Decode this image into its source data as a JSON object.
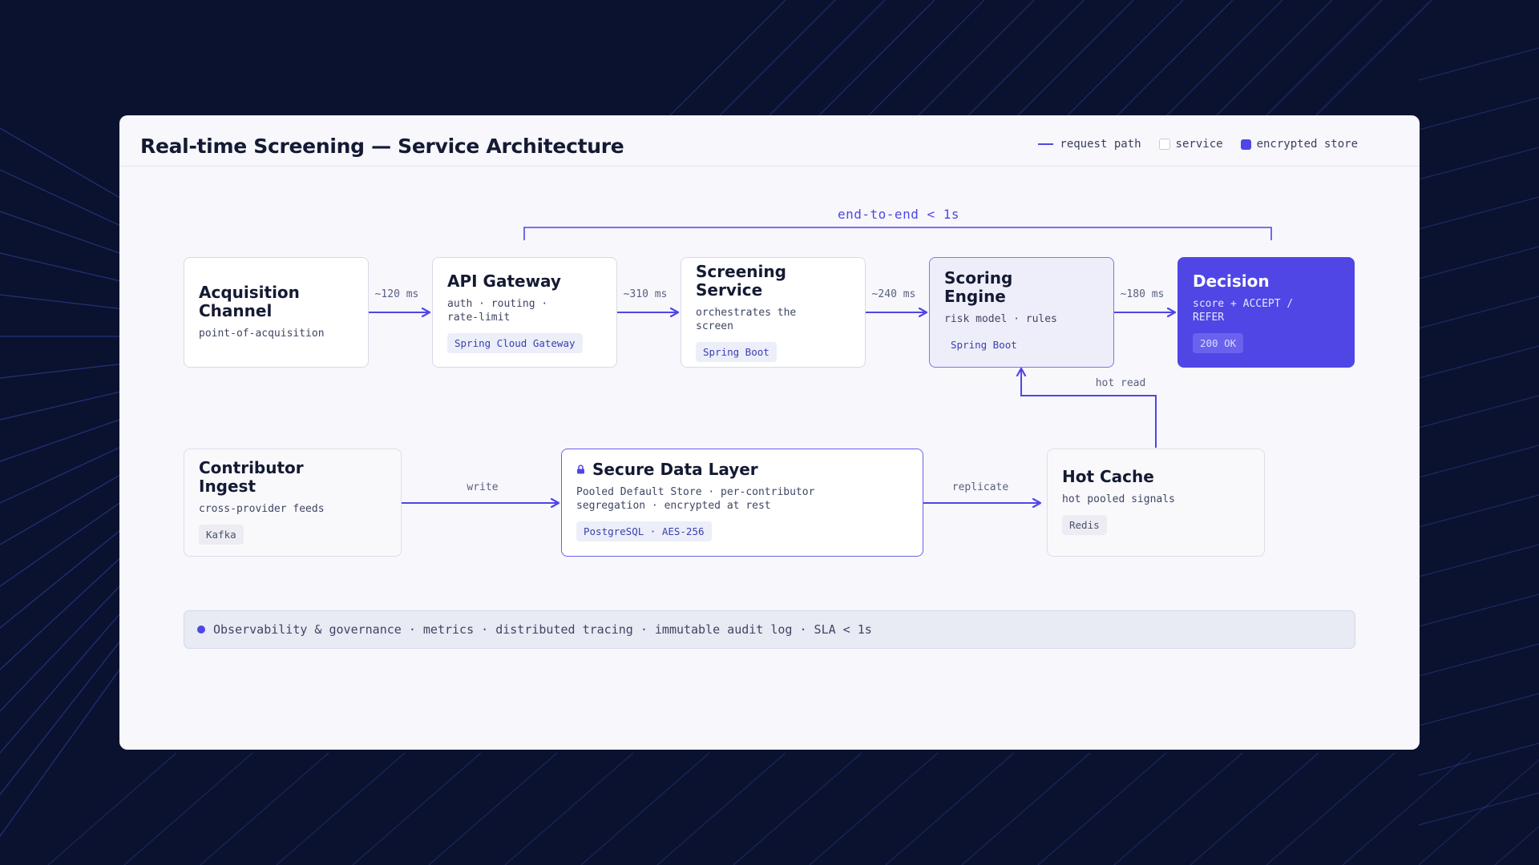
{
  "title": "Real-time Screening — Service Architecture",
  "legend": {
    "request_path": "request path",
    "service": "service",
    "encrypted_store": "encrypted store"
  },
  "e2e_label": "end-to-end < 1s",
  "nodes": {
    "acquisition": {
      "title": "Acquisition Channel",
      "sub": "point-of-acquisition"
    },
    "gateway": {
      "title": "API Gateway",
      "sub": "auth · routing · rate-limit",
      "tag": "Spring Cloud Gateway"
    },
    "screening": {
      "title": "Screening Service",
      "sub": "orchestrates the screen",
      "tag": "Spring Boot"
    },
    "scoring": {
      "title": "Scoring Engine",
      "sub": "risk model · rules",
      "tag": "Spring Boot"
    },
    "decision": {
      "title": "Decision",
      "sub": "score + ACCEPT / REFER",
      "tag": "200 OK"
    },
    "contributor": {
      "title": "Contributor Ingest",
      "sub": "cross-provider feeds",
      "tag": "Kafka"
    },
    "secure": {
      "title": "Secure Data Layer",
      "sub": "Pooled Default Store · per-contributor segregation · encrypted at rest",
      "tag": "PostgreSQL · AES-256"
    },
    "hotcache": {
      "title": "Hot Cache",
      "sub": "hot pooled signals",
      "tag": "Redis"
    }
  },
  "edges": {
    "acq_gateway": "~120 ms",
    "gateway_screening": "~310 ms",
    "screening_scoring": "~240 ms",
    "scoring_decision": "~180 ms",
    "write": "write",
    "replicate": "replicate",
    "hot_read": "hot read"
  },
  "observability": "Observability & governance · metrics · distributed tracing · immutable audit log · SLA < 1s",
  "colors": {
    "accent": "#4f46e5",
    "background": "#0b1230",
    "card": "#f7f7fc"
  }
}
